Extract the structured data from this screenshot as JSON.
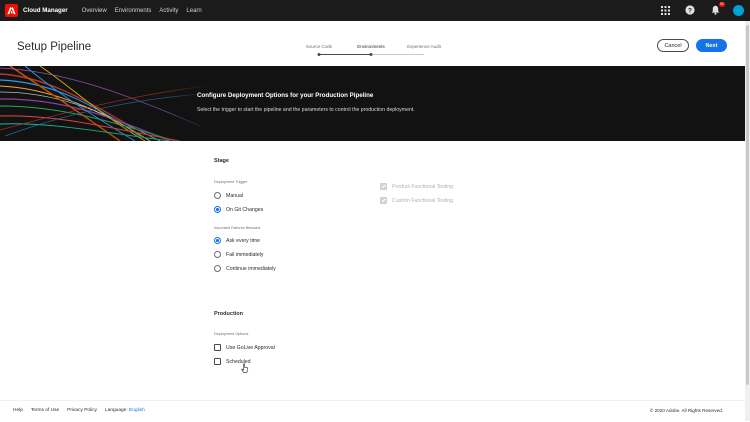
{
  "topnav": {
    "app_title": "Cloud Manager",
    "links": [
      "Overview",
      "Environments",
      "Activity",
      "Learn"
    ],
    "notification_count": "91"
  },
  "header": {
    "page_title": "Setup Pipeline",
    "steps": [
      {
        "label": "Source Code",
        "state": "done"
      },
      {
        "label": "Environments",
        "state": "current"
      },
      {
        "label": "Experience Audit",
        "state": "upcoming"
      }
    ],
    "cancel_label": "Cancel",
    "next_label": "Next"
  },
  "banner": {
    "title": "Configure Deployment Options for your Production Pipeline",
    "subtitle": "Select the trigger to start the pipeline and the parameters to control the production deployment."
  },
  "stage": {
    "title": "Stage",
    "trigger_label": "Deployment Trigger",
    "trigger_options": [
      {
        "label": "Manual",
        "selected": false
      },
      {
        "label": "On Git Changes",
        "selected": true
      }
    ],
    "failure_label": "Important Failures Behavior",
    "failure_options": [
      {
        "label": "Ask every time",
        "selected": true
      },
      {
        "label": "Fail immediately",
        "selected": false
      },
      {
        "label": "Continue immediately",
        "selected": false
      }
    ],
    "testing_options": [
      {
        "label": "Product Functional Testing",
        "checked": true,
        "disabled": true
      },
      {
        "label": "Custom Functional Testing",
        "checked": true,
        "disabled": true
      }
    ]
  },
  "production": {
    "title": "Production",
    "options_label": "Deployment Options",
    "options": [
      {
        "label": "Use GoLive Approval",
        "checked": false
      },
      {
        "label": "Scheduled",
        "checked": false
      }
    ]
  },
  "footer": {
    "links": [
      "Help",
      "Terms of Use",
      "Privacy Policy"
    ],
    "language_prefix": "Language:",
    "language": "English",
    "copyright": "© 2020 Adobe. All Rights Reserved."
  },
  "colors": {
    "accent": "#1473e6",
    "nav_bg": "#1b1b1b",
    "brand": "#eb1000",
    "banner_bg": "#121212"
  },
  "icons": {
    "app_logo": "adobe-logo-icon",
    "apps": "apps-grid-icon",
    "help": "help-icon",
    "notifications": "bell-icon"
  }
}
